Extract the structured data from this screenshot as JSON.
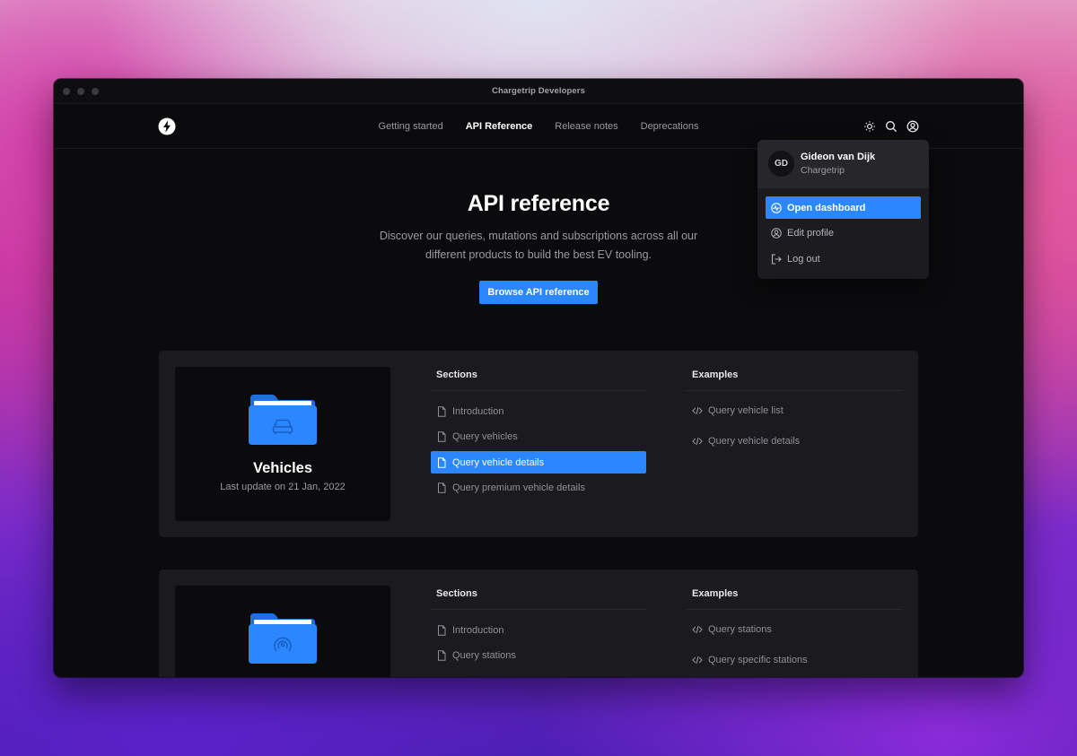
{
  "window": {
    "title": "Chargetrip Developers"
  },
  "nav": {
    "links": [
      {
        "label": "Getting started",
        "active": false
      },
      {
        "label": "API Reference",
        "active": true
      },
      {
        "label": "Release notes",
        "active": false
      },
      {
        "label": "Deprecations",
        "active": false
      }
    ],
    "icons": [
      "theme-icon",
      "search-icon",
      "user-icon"
    ]
  },
  "hero": {
    "title": "API reference",
    "description": "Discover our queries, mutations and subscriptions across all our different products to build the best EV tooling.",
    "button": "Browse API reference"
  },
  "cards": [
    {
      "title": "Vehicles",
      "subtitle": "Last update on 21 Jan, 2022",
      "icon": "car-folder-icon",
      "sections_header": "Sections",
      "sections": [
        {
          "label": "Introduction",
          "selected": false
        },
        {
          "label": "Query vehicles",
          "selected": false
        },
        {
          "label": "Query vehicle details",
          "selected": true
        },
        {
          "label": "Query premium vehicle details",
          "selected": false
        }
      ],
      "examples_header": "Examples",
      "examples": [
        "Query vehicle list",
        "Query vehicle details"
      ]
    },
    {
      "icon": "station-folder-icon",
      "sections_header": "Sections",
      "sections": [
        {
          "label": "Introduction",
          "selected": false
        },
        {
          "label": "Query stations",
          "selected": false
        }
      ],
      "examples_header": "Examples",
      "examples": [
        "Query stations",
        "Query specific stations"
      ]
    }
  ],
  "account_menu": {
    "initials": "GD",
    "name": "Gideon van Dijk",
    "organization": "Chargetrip",
    "items": [
      {
        "label": "Open dashboard",
        "icon": "activity-icon",
        "selected": true
      },
      {
        "label": "Edit profile",
        "icon": "user-circle-icon",
        "selected": false
      },
      {
        "label": "Log out",
        "icon": "logout-icon",
        "selected": false
      }
    ]
  },
  "colors": {
    "accent": "#2b87ff",
    "background": "#0b0b0d",
    "card": "#1b1b1f"
  }
}
